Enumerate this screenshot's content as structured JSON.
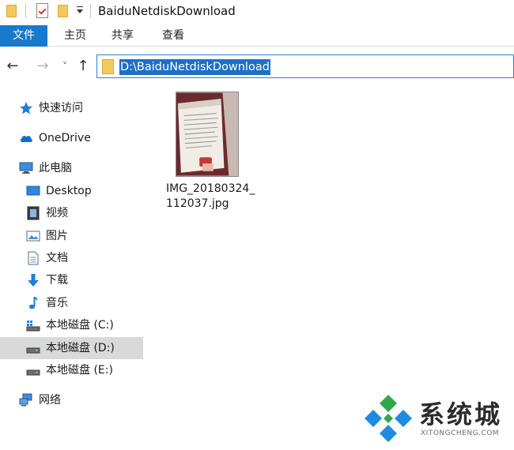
{
  "window": {
    "title": "BaiduNetdiskDownload"
  },
  "ribbon": {
    "tabs": [
      "文件",
      "主页",
      "共享",
      "查看"
    ]
  },
  "address": {
    "path": "D:\\BaiduNetdiskDownload"
  },
  "nav": {
    "items": [
      {
        "label": "快速访问",
        "icon": "star-icon"
      },
      {
        "label": "OneDrive",
        "icon": "cloud-icon"
      },
      {
        "label": "此电脑",
        "icon": "computer-icon"
      },
      {
        "label": "Desktop",
        "icon": "desktop-icon"
      },
      {
        "label": "视频",
        "icon": "video-icon"
      },
      {
        "label": "图片",
        "icon": "pictures-icon"
      },
      {
        "label": "文档",
        "icon": "document-icon"
      },
      {
        "label": "下载",
        "icon": "download-arrow-icon"
      },
      {
        "label": "音乐",
        "icon": "music-note-icon"
      },
      {
        "label": "本地磁盘 (C:)",
        "icon": "system-drive-icon"
      },
      {
        "label": "本地磁盘 (D:)",
        "icon": "drive-icon",
        "selected": true
      },
      {
        "label": "本地磁盘 (E:)",
        "icon": "drive-icon"
      },
      {
        "label": "网络",
        "icon": "network-icon"
      }
    ]
  },
  "files": [
    {
      "name_line1": "IMG_20180324_",
      "name_line2": "112037.jpg"
    }
  ],
  "watermark": {
    "zh": "系统城",
    "en": "XITONGCHENG.COM"
  },
  "colors": {
    "ribbon_file_tab": "#1979ca",
    "selection": "#1e6fc7",
    "nav_selected": "#d9d9d9",
    "folder": "#f4c95c",
    "logo_green": "#2ea84a",
    "logo_blue": "#1f8be0"
  }
}
